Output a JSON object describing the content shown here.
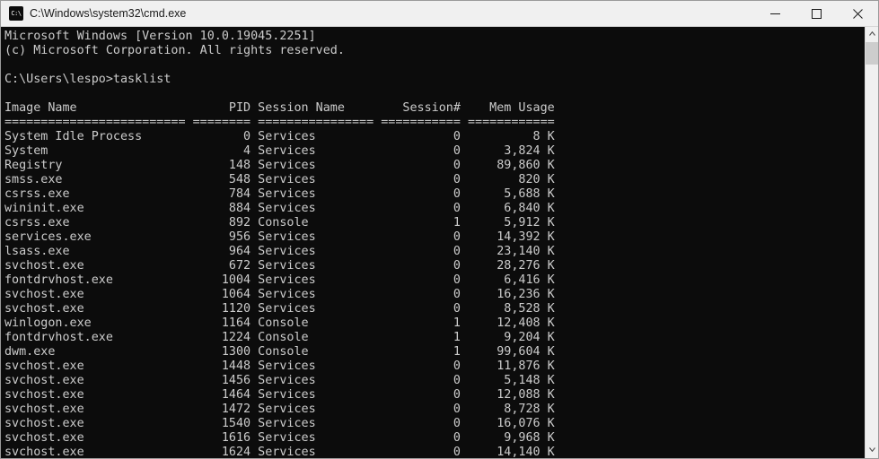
{
  "window": {
    "title": "C:\\Windows\\system32\\cmd.exe",
    "icon": "cmd-icon",
    "icon_glyph": "C:\\",
    "background_color": "#0c0c0c",
    "foreground_color": "#cccccc",
    "titlebar_color": "#f0f0f0",
    "controls": {
      "minimize": "minimize-icon",
      "maximize": "maximize-icon",
      "close": "close-icon"
    }
  },
  "terminal": {
    "banner": [
      "Microsoft Windows [Version 10.0.19045.2251]",
      "(c) Microsoft Corporation. All rights reserved."
    ],
    "blank_line": "",
    "prompt": "C:\\Users\\lespo>",
    "command": "tasklist",
    "columns": [
      {
        "header": "Image Name",
        "width": 25,
        "align": "left"
      },
      {
        "header": "PID",
        "width": 8,
        "align": "right"
      },
      {
        "header": "Session Name",
        "width": 16,
        "align": "left"
      },
      {
        "header": "Session#",
        "width": 11,
        "align": "right"
      },
      {
        "header": "Mem Usage",
        "width": 12,
        "align": "right"
      }
    ],
    "separator_char": "=",
    "rows": [
      {
        "image_name": "System Idle Process",
        "pid": "0",
        "session_name": "Services",
        "session_num": "0",
        "mem_usage": "8 K"
      },
      {
        "image_name": "System",
        "pid": "4",
        "session_name": "Services",
        "session_num": "0",
        "mem_usage": "3,824 K"
      },
      {
        "image_name": "Registry",
        "pid": "148",
        "session_name": "Services",
        "session_num": "0",
        "mem_usage": "89,860 K"
      },
      {
        "image_name": "smss.exe",
        "pid": "548",
        "session_name": "Services",
        "session_num": "0",
        "mem_usage": "820 K"
      },
      {
        "image_name": "csrss.exe",
        "pid": "784",
        "session_name": "Services",
        "session_num": "0",
        "mem_usage": "5,688 K"
      },
      {
        "image_name": "wininit.exe",
        "pid": "884",
        "session_name": "Services",
        "session_num": "0",
        "mem_usage": "6,840 K"
      },
      {
        "image_name": "csrss.exe",
        "pid": "892",
        "session_name": "Console",
        "session_num": "1",
        "mem_usage": "5,912 K"
      },
      {
        "image_name": "services.exe",
        "pid": "956",
        "session_name": "Services",
        "session_num": "0",
        "mem_usage": "14,392 K"
      },
      {
        "image_name": "lsass.exe",
        "pid": "964",
        "session_name": "Services",
        "session_num": "0",
        "mem_usage": "23,140 K"
      },
      {
        "image_name": "svchost.exe",
        "pid": "672",
        "session_name": "Services",
        "session_num": "0",
        "mem_usage": "28,276 K"
      },
      {
        "image_name": "fontdrvhost.exe",
        "pid": "1004",
        "session_name": "Services",
        "session_num": "0",
        "mem_usage": "6,416 K"
      },
      {
        "image_name": "svchost.exe",
        "pid": "1064",
        "session_name": "Services",
        "session_num": "0",
        "mem_usage": "16,236 K"
      },
      {
        "image_name": "svchost.exe",
        "pid": "1120",
        "session_name": "Services",
        "session_num": "0",
        "mem_usage": "8,528 K"
      },
      {
        "image_name": "winlogon.exe",
        "pid": "1164",
        "session_name": "Console",
        "session_num": "1",
        "mem_usage": "12,408 K"
      },
      {
        "image_name": "fontdrvhost.exe",
        "pid": "1224",
        "session_name": "Console",
        "session_num": "1",
        "mem_usage": "9,204 K"
      },
      {
        "image_name": "dwm.exe",
        "pid": "1300",
        "session_name": "Console",
        "session_num": "1",
        "mem_usage": "99,604 K"
      },
      {
        "image_name": "svchost.exe",
        "pid": "1448",
        "session_name": "Services",
        "session_num": "0",
        "mem_usage": "11,876 K"
      },
      {
        "image_name": "svchost.exe",
        "pid": "1456",
        "session_name": "Services",
        "session_num": "0",
        "mem_usage": "5,148 K"
      },
      {
        "image_name": "svchost.exe",
        "pid": "1464",
        "session_name": "Services",
        "session_num": "0",
        "mem_usage": "12,088 K"
      },
      {
        "image_name": "svchost.exe",
        "pid": "1472",
        "session_name": "Services",
        "session_num": "0",
        "mem_usage": "8,728 K"
      },
      {
        "image_name": "svchost.exe",
        "pid": "1540",
        "session_name": "Services",
        "session_num": "0",
        "mem_usage": "16,076 K"
      },
      {
        "image_name": "svchost.exe",
        "pid": "1616",
        "session_name": "Services",
        "session_num": "0",
        "mem_usage": "9,968 K"
      },
      {
        "image_name": "svchost.exe",
        "pid": "1624",
        "session_name": "Services",
        "session_num": "0",
        "mem_usage": "14,140 K"
      }
    ]
  },
  "scrollbar": {
    "up_arrow": "chevron-up-icon",
    "down_arrow": "chevron-down-icon",
    "thumb_top_pct": 0,
    "thumb_height_pct": 5.6
  }
}
